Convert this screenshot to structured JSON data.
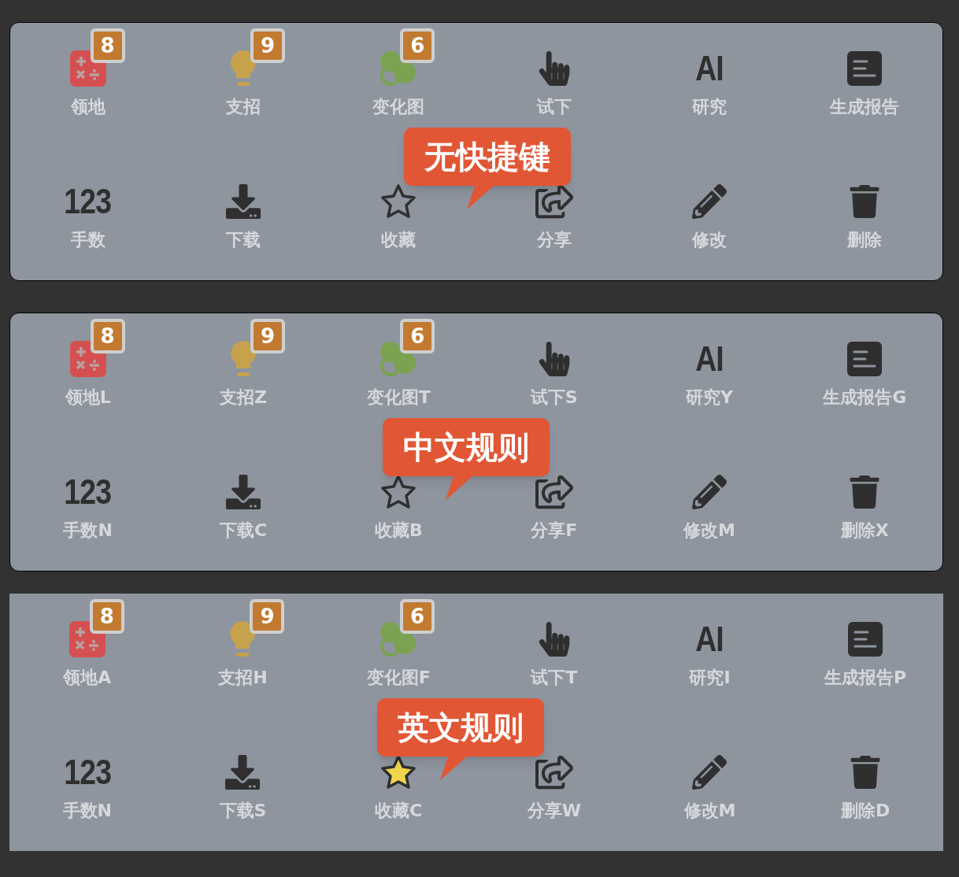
{
  "panels": [
    {
      "callout": "无快捷键",
      "items": [
        {
          "kind": "calculator",
          "label": "领地",
          "badge": "8"
        },
        {
          "kind": "bulb",
          "label": "支招",
          "badge": "9"
        },
        {
          "kind": "circles",
          "label": "变化图",
          "badge": "6"
        },
        {
          "kind": "hand",
          "label": "试下"
        },
        {
          "kind": "text",
          "icon_text": "AI",
          "label": "研究"
        },
        {
          "kind": "report",
          "label": "生成报告"
        },
        {
          "kind": "text",
          "icon_text": "123",
          "label": "手数"
        },
        {
          "kind": "download",
          "label": "下载"
        },
        {
          "kind": "star",
          "label": "收藏",
          "selected": false
        },
        {
          "kind": "share",
          "label": "分享"
        },
        {
          "kind": "pencil",
          "label": "修改"
        },
        {
          "kind": "trash",
          "label": "删除"
        }
      ]
    },
    {
      "callout": "中文规则",
      "items": [
        {
          "kind": "calculator",
          "label": "领地L",
          "badge": "8"
        },
        {
          "kind": "bulb",
          "label": "支招Z",
          "badge": "9"
        },
        {
          "kind": "circles",
          "label": "变化图T",
          "badge": "6"
        },
        {
          "kind": "hand",
          "label": "试下S"
        },
        {
          "kind": "text",
          "icon_text": "AI",
          "label": "研究Y"
        },
        {
          "kind": "report",
          "label": "生成报告G"
        },
        {
          "kind": "text",
          "icon_text": "123",
          "label": "手数N"
        },
        {
          "kind": "download",
          "label": "下载C"
        },
        {
          "kind": "star",
          "label": "收藏B",
          "selected": false
        },
        {
          "kind": "share",
          "label": "分享F"
        },
        {
          "kind": "pencil",
          "label": "修改M"
        },
        {
          "kind": "trash",
          "label": "删除X"
        }
      ]
    },
    {
      "callout": "英文规则",
      "items": [
        {
          "kind": "calculator",
          "label": "领地A",
          "badge": "8"
        },
        {
          "kind": "bulb",
          "label": "支招H",
          "badge": "9"
        },
        {
          "kind": "circles",
          "label": "变化图F",
          "badge": "6"
        },
        {
          "kind": "hand",
          "label": "试下T"
        },
        {
          "kind": "text",
          "icon_text": "AI",
          "label": "研究I"
        },
        {
          "kind": "report",
          "label": "生成报告P"
        },
        {
          "kind": "text",
          "icon_text": "123",
          "label": "手数N"
        },
        {
          "kind": "download",
          "label": "下载S"
        },
        {
          "kind": "star",
          "label": "收藏C",
          "selected": true
        },
        {
          "kind": "share",
          "label": "分享W"
        },
        {
          "kind": "pencil",
          "label": "修改M"
        },
        {
          "kind": "trash",
          "label": "删除D"
        }
      ]
    }
  ]
}
